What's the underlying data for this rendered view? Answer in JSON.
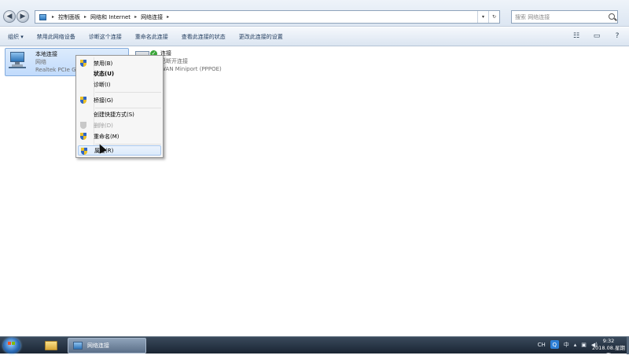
{
  "address": {
    "crumbs": [
      "控制面板",
      "网络和 Internet",
      "网络连接"
    ]
  },
  "search": {
    "placeholder": "搜索 网络连接"
  },
  "toolbar": {
    "organize": "组织 ▾",
    "items": [
      "禁用此网络设备",
      "诊断这个连接",
      "重命名此连接",
      "查看此连接的状态",
      "更改此连接的设置"
    ]
  },
  "connections": [
    {
      "name": "本地连接",
      "type": "网络",
      "adapter": "Realtek PCIe G"
    },
    {
      "name": "连接",
      "status": "已断开连接",
      "adapter": "WAN Miniport (PPPOE)"
    }
  ],
  "context_menu": {
    "items": [
      {
        "label": "禁用(B)",
        "icon": "shield-icon",
        "bold": false,
        "disabled": false
      },
      {
        "label": "状态(U)",
        "icon": "",
        "bold": true,
        "disabled": false
      },
      {
        "label": "诊断(I)",
        "icon": "",
        "bold": false,
        "disabled": false
      },
      {
        "label": "桥接(G)",
        "icon": "shield-icon",
        "bold": false,
        "disabled": false
      },
      {
        "label": "创建快捷方式(S)",
        "icon": "",
        "bold": false,
        "disabled": false
      },
      {
        "label": "删除(D)",
        "icon": "shield-icon",
        "bold": false,
        "disabled": true
      },
      {
        "label": "重命名(M)",
        "icon": "shield-icon",
        "bold": false,
        "disabled": false
      },
      {
        "label": "属性(R)",
        "icon": "shield-icon",
        "bold": false,
        "disabled": false,
        "hover": true
      }
    ]
  },
  "taskbar": {
    "task_label": "网络连接",
    "tray": {
      "ime": "CH",
      "ime_mode": "中"
    },
    "clock": {
      "time": "9:32",
      "date": "2018.08.星期五"
    }
  },
  "colors": {
    "accent": "#84acdd",
    "selection": "#c1dbfc",
    "taskbar": "#1a2533"
  }
}
